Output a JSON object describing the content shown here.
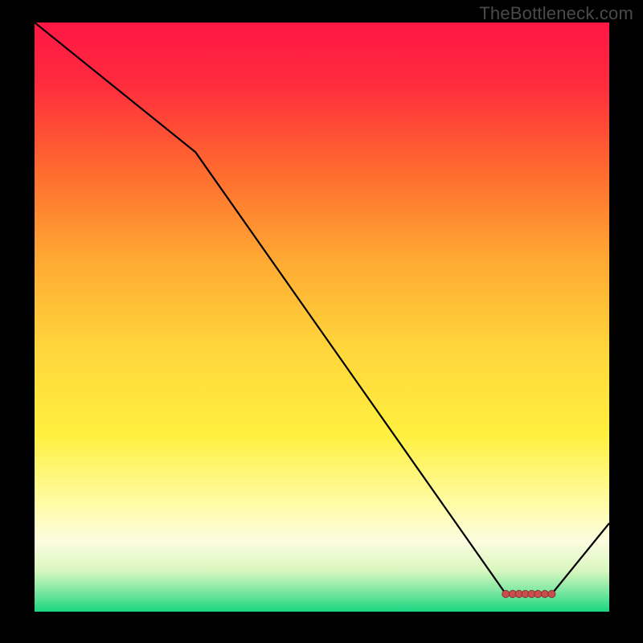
{
  "attribution": "TheBottleneck.com",
  "colors": {
    "bg": "#000000",
    "attribution_text": "#4a4a4a",
    "curve": "#000000",
    "marker_fill": "#c94f4f",
    "marker_stroke": "#8a2f2f"
  },
  "chart_data": {
    "type": "line",
    "title": "",
    "xlabel": "",
    "ylabel": "",
    "xlim": [
      0,
      100
    ],
    "ylim": [
      0,
      100
    ],
    "x": [
      0,
      28,
      82,
      90,
      100
    ],
    "values": [
      100,
      78,
      3,
      3,
      15
    ],
    "minimum_plateau": {
      "x_start": 82,
      "x_end": 90,
      "y": 3
    },
    "gradient_stops": [
      {
        "pos": 0.0,
        "color": "#ff1745"
      },
      {
        "pos": 0.1,
        "color": "#ff2a3e"
      },
      {
        "pos": 0.25,
        "color": "#ff6a2f"
      },
      {
        "pos": 0.4,
        "color": "#ffa833"
      },
      {
        "pos": 0.55,
        "color": "#ffd53b"
      },
      {
        "pos": 0.7,
        "color": "#fff03f"
      },
      {
        "pos": 0.82,
        "color": "#fffca8"
      },
      {
        "pos": 0.88,
        "color": "#fcfce0"
      },
      {
        "pos": 0.93,
        "color": "#d9f7c0"
      },
      {
        "pos": 0.965,
        "color": "#7fe8a2"
      },
      {
        "pos": 1.0,
        "color": "#18d680"
      }
    ],
    "markers_x": [
      82,
      83.2,
      84.3,
      85.4,
      86.5,
      87.6,
      88.8,
      90
    ]
  }
}
